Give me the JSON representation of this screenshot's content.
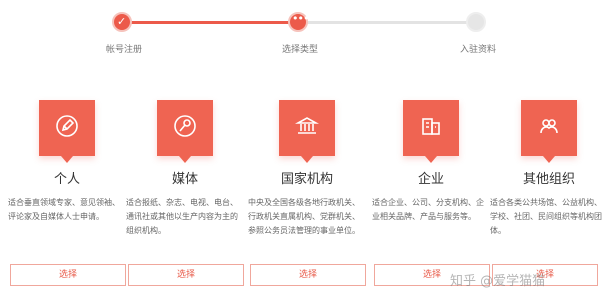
{
  "steps": [
    {
      "label": "帐号注册",
      "state": "done"
    },
    {
      "label": "选择类型",
      "state": "current"
    },
    {
      "label": "入驻资料",
      "state": "todo"
    }
  ],
  "cards": [
    {
      "title": "个人",
      "icon": "pen-icon",
      "desc": "适合垂直领域专家、意见领袖、评论家及自媒体人士申请。",
      "button": "选择"
    },
    {
      "title": "媒体",
      "icon": "microphone-icon",
      "desc": "适合报纸、杂志、电视、电台、通讯社或其他以生产内容为主的组织机构。",
      "button": "选择"
    },
    {
      "title": "国家机构",
      "icon": "institution-icon",
      "desc": "中央及全国各级各地行政机关、行政机关直属机构、党群机关、参照公务员法管理的事业单位。",
      "button": "选择"
    },
    {
      "title": "企业",
      "icon": "building-icon",
      "desc": "适合企业、公司、分支机构、企业相关品牌、产品与服务等。",
      "button": "选择"
    },
    {
      "title": "其他组织",
      "icon": "group-icon",
      "desc": "适合各类公共场馆、公益机构、学校、社团、民间组织等机构团体。",
      "button": "选择"
    }
  ],
  "watermark": "知乎 @爱学猫猫",
  "colors": {
    "accent": "#ef6452",
    "inactive": "#e3e3e3"
  }
}
